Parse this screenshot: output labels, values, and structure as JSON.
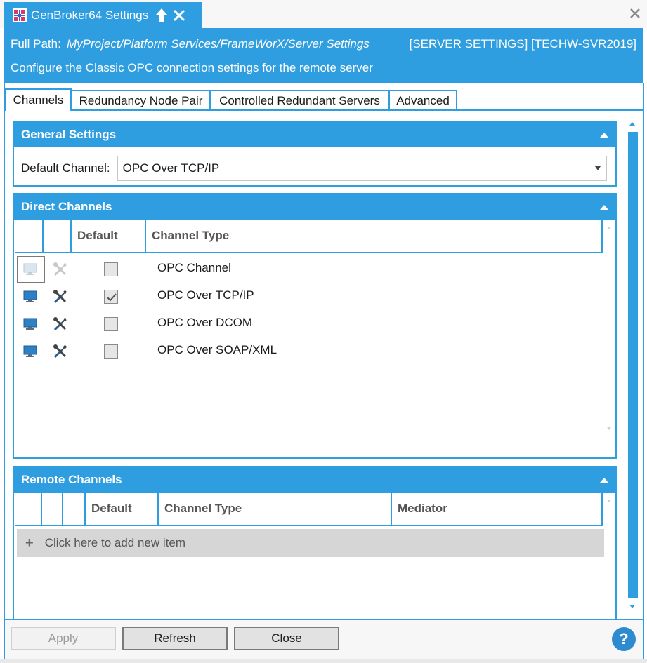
{
  "window": {
    "tab_title": "GenBroker64 Settings",
    "icons": {
      "app": "app-grid-icon",
      "pin": "pin-up-arrow-icon",
      "tab_close": "close-icon",
      "window_close": "close-icon"
    }
  },
  "header": {
    "path_label": "Full Path:",
    "path_value": "MyProject/Platform Services/FrameWorX/Server Settings",
    "server_id": "[SERVER SETTINGS] [TECHW-SVR2019]",
    "description": "Configure the Classic OPC connection settings for the remote server"
  },
  "tabs": [
    {
      "label": "Channels",
      "active": true
    },
    {
      "label": "Redundancy Node Pair",
      "active": false
    },
    {
      "label": "Controlled Redundant Servers",
      "active": false
    },
    {
      "label": "Advanced",
      "active": false
    }
  ],
  "general": {
    "title": "General Settings",
    "default_channel_label": "Default Channel:",
    "default_channel_value": "OPC Over TCP/IP"
  },
  "direct": {
    "title": "Direct Channels",
    "columns": [
      "Default",
      "Channel Type"
    ],
    "rows": [
      {
        "channel_type": "OPC Channel",
        "default": false,
        "enabled": false
      },
      {
        "channel_type": "OPC Over TCP/IP",
        "default": true,
        "enabled": true
      },
      {
        "channel_type": "OPC Over DCOM",
        "default": false,
        "enabled": true
      },
      {
        "channel_type": "OPC Over SOAP/XML",
        "default": false,
        "enabled": true
      }
    ]
  },
  "remote": {
    "title": "Remote Channels",
    "columns": [
      "Default",
      "Channel Type",
      "Mediator"
    ],
    "add_new_label": "Click here to add new item"
  },
  "footer": {
    "apply_label": "Apply",
    "refresh_label": "Refresh",
    "close_label": "Close",
    "help_label": "?"
  },
  "colors": {
    "accent": "#2f9ee0",
    "add_row_bg": "#d6d6d6"
  }
}
